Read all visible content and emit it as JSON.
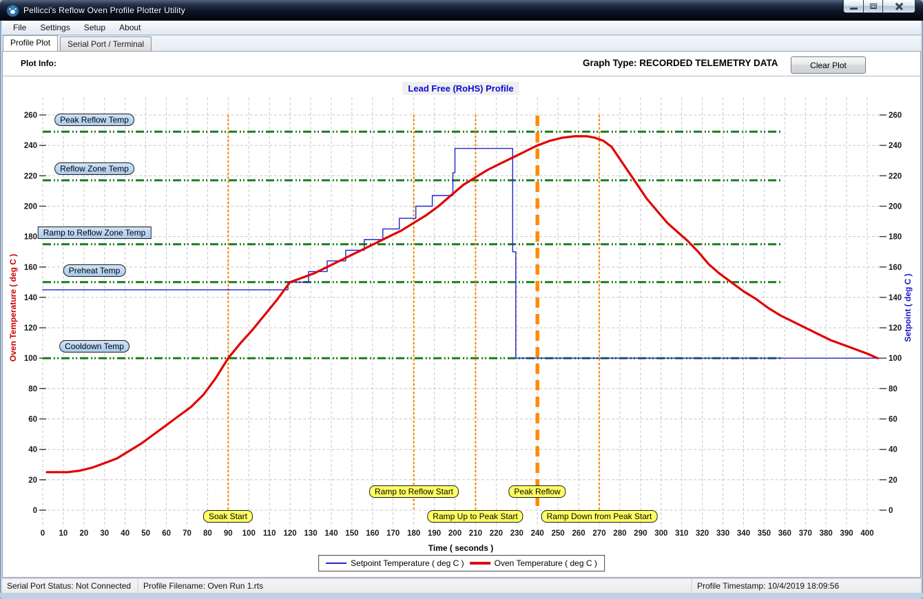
{
  "window": {
    "title": "Pellicci's Reflow Oven Profile Plotter Utility"
  },
  "menu": {
    "items": [
      {
        "label": "File"
      },
      {
        "label": "Settings"
      },
      {
        "label": "Setup"
      },
      {
        "label": "About"
      }
    ]
  },
  "tabs": [
    {
      "label": "Profile Plot",
      "active": true
    },
    {
      "label": "Serial Port / Terminal",
      "active": false
    }
  ],
  "header": {
    "plot_info": "Plot Info:",
    "graph_type": "Graph Type: RECORDED TELEMETRY DATA",
    "clear_plot": "Clear Plot"
  },
  "chart_data": {
    "type": "line",
    "title": "Lead Free (RoHS) Profile",
    "xlabel": "Time ( seconds )",
    "ylabel_left": "Oven Temperature ( deg C )",
    "ylabel_right": "Setpoint ( deg C )",
    "xlim": [
      0,
      406
    ],
    "ylim": [
      0,
      268
    ],
    "grid": true,
    "x_ticks": [
      0,
      10,
      20,
      30,
      40,
      50,
      60,
      70,
      80,
      90,
      100,
      110,
      120,
      130,
      140,
      150,
      160,
      170,
      180,
      190,
      200,
      210,
      220,
      230,
      240,
      250,
      260,
      270,
      280,
      290,
      300,
      310,
      320,
      330,
      340,
      350,
      360,
      370,
      380,
      390,
      400
    ],
    "y_ticks": [
      0,
      20,
      40,
      60,
      80,
      100,
      120,
      140,
      160,
      180,
      200,
      220,
      240,
      260
    ],
    "series": [
      {
        "name": "Setpoint Temperature ( deg C )",
        "color": "#2222cc",
        "width": 1.4,
        "points": [
          [
            0,
            145
          ],
          [
            119,
            145
          ],
          [
            119,
            150
          ],
          [
            129,
            150
          ],
          [
            129,
            157
          ],
          [
            138,
            157
          ],
          [
            138,
            164
          ],
          [
            147,
            164
          ],
          [
            147,
            171
          ],
          [
            156,
            171
          ],
          [
            156,
            178
          ],
          [
            165,
            178
          ],
          [
            165,
            185
          ],
          [
            173,
            185
          ],
          [
            173,
            192
          ],
          [
            181,
            192
          ],
          [
            181,
            200
          ],
          [
            189,
            200
          ],
          [
            189,
            207
          ],
          [
            199,
            207
          ],
          [
            199,
            222
          ],
          [
            200,
            222
          ],
          [
            200,
            238
          ],
          [
            228,
            238
          ],
          [
            228,
            170
          ],
          [
            229.5,
            170
          ],
          [
            229.5,
            100
          ],
          [
            406,
            100
          ]
        ]
      },
      {
        "name": "Oven Temperature ( deg C )",
        "color": "#e00000",
        "width": 3.2,
        "points": [
          [
            2,
            25
          ],
          [
            12,
            25
          ],
          [
            18,
            26
          ],
          [
            24,
            28
          ],
          [
            30,
            31
          ],
          [
            36,
            34
          ],
          [
            42,
            39
          ],
          [
            48,
            44
          ],
          [
            54,
            50
          ],
          [
            60,
            56
          ],
          [
            66,
            62
          ],
          [
            72,
            68
          ],
          [
            78,
            76
          ],
          [
            84,
            87
          ],
          [
            90,
            100
          ],
          [
            96,
            110
          ],
          [
            102,
            119
          ],
          [
            108,
            129
          ],
          [
            114,
            139
          ],
          [
            120,
            150
          ],
          [
            126,
            153
          ],
          [
            132,
            156
          ],
          [
            138,
            160
          ],
          [
            144,
            164
          ],
          [
            150,
            168
          ],
          [
            156,
            172
          ],
          [
            162,
            176
          ],
          [
            168,
            180
          ],
          [
            174,
            184
          ],
          [
            180,
            189
          ],
          [
            186,
            194
          ],
          [
            192,
            200
          ],
          [
            198,
            207
          ],
          [
            204,
            214
          ],
          [
            210,
            219
          ],
          [
            216,
            224
          ],
          [
            222,
            228
          ],
          [
            228,
            232
          ],
          [
            234,
            236
          ],
          [
            240,
            240
          ],
          [
            246,
            243
          ],
          [
            252,
            245
          ],
          [
            258,
            246
          ],
          [
            264,
            246
          ],
          [
            268,
            245
          ],
          [
            272,
            243
          ],
          [
            276,
            239
          ],
          [
            280,
            231
          ],
          [
            284,
            223
          ],
          [
            288,
            215
          ],
          [
            293,
            205
          ],
          [
            298,
            197
          ],
          [
            303,
            189
          ],
          [
            308,
            183
          ],
          [
            313,
            177
          ],
          [
            318,
            170
          ],
          [
            323,
            162
          ],
          [
            328,
            156
          ],
          [
            334,
            150
          ],
          [
            340,
            144
          ],
          [
            346,
            139
          ],
          [
            352,
            133
          ],
          [
            358,
            128
          ],
          [
            364,
            124
          ],
          [
            370,
            120
          ],
          [
            376,
            116
          ],
          [
            382,
            112
          ],
          [
            388,
            109
          ],
          [
            394,
            106
          ],
          [
            400,
            103
          ],
          [
            405,
            100
          ]
        ]
      }
    ],
    "thresholds": [
      {
        "label": "Peak Reflow Temp",
        "value": 249,
        "box": "rounded"
      },
      {
        "label": "Reflow Zone Temp",
        "value": 217,
        "box": "rounded"
      },
      {
        "label": "Ramp to Reflow Zone Temp",
        "value": 175,
        "box": "rect"
      },
      {
        "label": "Preheat Temp",
        "value": 150,
        "box": "rounded"
      },
      {
        "label": "Cooldown Temp",
        "value": 100,
        "box": "rounded"
      }
    ],
    "threshold_color": "#1c7c1c",
    "threshold_x_end": 358,
    "events": [
      {
        "label": "Soak Start",
        "time": 90,
        "row": "low",
        "thick": false
      },
      {
        "label": "Ramp to Reflow Start",
        "time": 180,
        "row": "high",
        "thick": false
      },
      {
        "label": "Ramp Up to Peak Start",
        "time": 210,
        "row": "low",
        "thick": false
      },
      {
        "label": "Peak Reflow",
        "time": 240,
        "row": "high",
        "thick": true
      },
      {
        "label": "Ramp Down from Peak Start",
        "time": 270,
        "row": "low",
        "thick": false
      }
    ],
    "event_color": "#ff8c00"
  },
  "legend": {
    "items": [
      {
        "label": "Setpoint Temperature ( deg C )",
        "color": "#2222cc",
        "width": 2
      },
      {
        "label": "Oven Temperature ( deg C )",
        "color": "#e00000",
        "width": 4
      }
    ]
  },
  "status_bar": {
    "serial_status": "Serial Port Status: Not Connected",
    "profile_filename": "Profile Filename: Oven Run 1.rts",
    "profile_timestamp": "Profile Timestamp:  10/4/2019 18:09:56"
  }
}
